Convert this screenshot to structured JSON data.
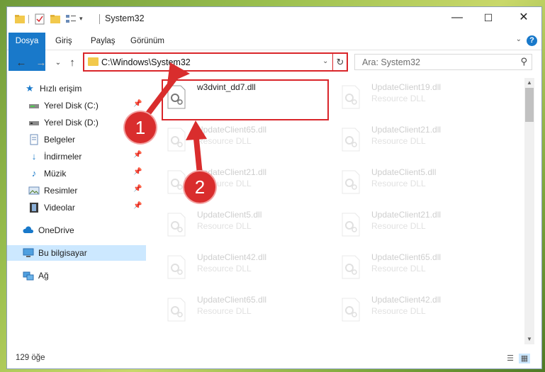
{
  "window": {
    "title": "System32",
    "minimize_label": "—",
    "maximize_label": "☐",
    "close_label": "✕"
  },
  "ribbon": {
    "tabs": [
      "Dosya",
      "Giriş",
      "Paylaş",
      "Görünüm"
    ],
    "help_label": "?"
  },
  "address_bar": {
    "path": "C:\\Windows\\System32",
    "dropdown_glyph": "⌄",
    "refresh_glyph": "↻"
  },
  "search": {
    "placeholder": "Ara: System32",
    "icon": "search-icon"
  },
  "nav": {
    "back": "←",
    "forward": "→",
    "recent": "⌄",
    "up": "↑"
  },
  "nav_pane": {
    "items": [
      {
        "label": "Hızlı erişim",
        "icon": "star-icon",
        "pinned": false
      },
      {
        "label": "Yerel Disk (C:)",
        "icon": "drive-icon",
        "pinned": true
      },
      {
        "label": "Yerel Disk (D:)",
        "icon": "drive-icon",
        "pinned": true
      },
      {
        "label": "Belgeler",
        "icon": "documents-icon",
        "pinned": true
      },
      {
        "label": "İndirmeler",
        "icon": "downloads-icon",
        "pinned": true
      },
      {
        "label": "Müzik",
        "icon": "music-icon",
        "pinned": true
      },
      {
        "label": "Resimler",
        "icon": "pictures-icon",
        "pinned": true
      },
      {
        "label": "Videolar",
        "icon": "videos-icon",
        "pinned": true
      },
      {
        "label": "OneDrive",
        "icon": "cloud-icon",
        "pinned": false
      },
      {
        "label": "Bu bilgisayar",
        "icon": "computer-icon",
        "pinned": false,
        "selected": true
      },
      {
        "label": "Ağ",
        "icon": "network-icon",
        "pinned": false
      }
    ]
  },
  "files": [
    {
      "name": "w3dvint_dd7.dll",
      "desc": ""
    },
    {
      "name": "UpdateClient19.dll",
      "desc": "Resource DLL"
    },
    {
      "name": "UpdateClient65.dll",
      "desc": "Resource DLL"
    },
    {
      "name": "UpdateClient21.dll",
      "desc": "Resource DLL"
    },
    {
      "name": "UpdateClient21.dll",
      "desc": "Resource DLL"
    },
    {
      "name": "UpdateClient5.dll",
      "desc": "Resource DLL"
    },
    {
      "name": "UpdateClient5.dll",
      "desc": "Resource DLL"
    },
    {
      "name": "UpdateClient21.dll",
      "desc": "Resource DLL"
    },
    {
      "name": "UpdateClient42.dll",
      "desc": "Resource DLL"
    },
    {
      "name": "UpdateClient65.dll",
      "desc": "Resource DLL"
    },
    {
      "name": "UpdateClient65.dll",
      "desc": "Resource DLL"
    },
    {
      "name": "UpdateClient42.dll",
      "desc": "Resource DLL"
    }
  ],
  "status_bar": {
    "item_count": "129 öğe"
  },
  "annotations": {
    "marker_1": "1",
    "marker_2": "2"
  },
  "colors": {
    "accent": "#1979ca",
    "highlight": "#d9252a",
    "selection": "#cce8ff"
  }
}
